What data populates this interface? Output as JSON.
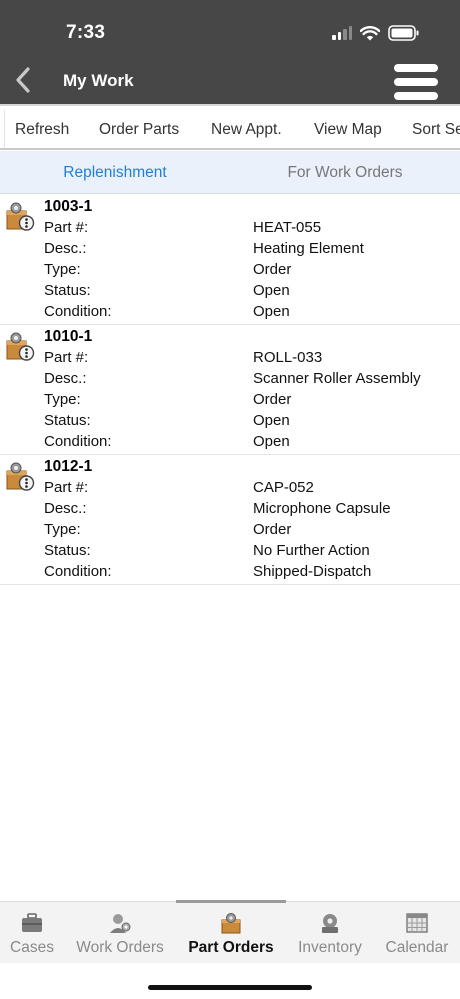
{
  "status_bar": {
    "time": "7:33"
  },
  "nav": {
    "title": "My Work",
    "back_icon": "chevron-left-icon",
    "menu_icon": "hamburger-menu-icon"
  },
  "toolbar": {
    "refresh": "Refresh",
    "order_parts": "Order Parts",
    "new_appt": "New Appt.",
    "view_map": "View Map",
    "sort": "Sort Se"
  },
  "tabs": {
    "replenishment": "Replenishment",
    "for_work_orders": "For Work Orders"
  },
  "labels": {
    "part": "Part #:",
    "desc": "Desc.:",
    "type": "Type:",
    "status": "Status:",
    "condition": "Condition:"
  },
  "rows": [
    {
      "id": "1003-1",
      "part": "HEAT-055",
      "desc": "Heating Element",
      "type": "Order",
      "status": "Open",
      "condition": "Open"
    },
    {
      "id": "1010-1",
      "part": "ROLL-033",
      "desc": "Scanner Roller Assembly",
      "type": "Order",
      "status": "Open",
      "condition": "Open"
    },
    {
      "id": "1012-1",
      "part": "CAP-052",
      "desc": "Microphone Capsule",
      "type": "Order",
      "status": "No Further Action",
      "condition": "Shipped-Dispatch"
    }
  ],
  "bottom_tabs": {
    "cases": "Cases",
    "work_orders": "Work Orders",
    "part_orders": "Part Orders",
    "inventory": "Inventory",
    "calendar": "Calendar"
  },
  "colors": {
    "header": "#474747",
    "active_tab": "#1f80d8",
    "tab_bg": "#eaf1fb"
  }
}
